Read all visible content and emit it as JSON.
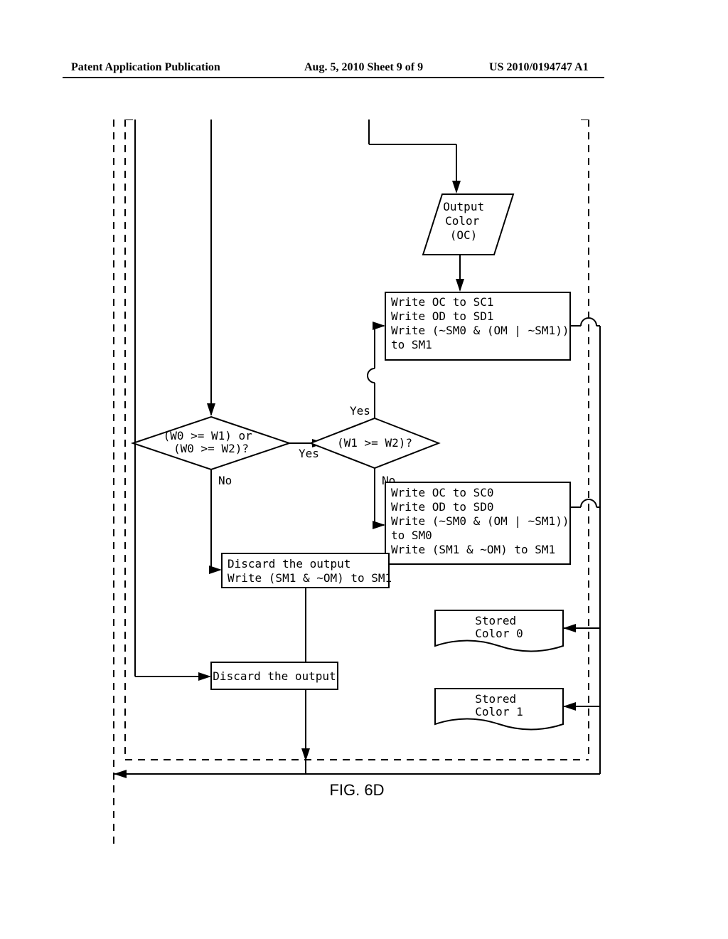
{
  "header": {
    "left": "Patent Application Publication",
    "center": "Aug. 5, 2010  Sheet 9 of 9",
    "right": "US 2010/0194747 A1"
  },
  "nodes": {
    "output_color": "Output\nColor\n(OC)",
    "write_sc1": "Write OC to SC1\nWrite OD to SD1\nWrite (~SM0 & (OM | ~SM1))\nto SM1",
    "decision1": "(W0 >= W1) or\n(W0 >= W2)?",
    "decision2": "(W1 >= W2)?",
    "write_sc0": "Write OC to SC0\nWrite OD to SD0\nWrite (~SM0 & (OM | ~SM1))\nto SM0\nWrite (SM1 & ~OM) to SM1",
    "discard_sm1": "Discard the output\nWrite (SM1 & ~OM) to SM1",
    "discard": "Discard the output",
    "stored0": "Stored\nColor 0",
    "stored1": "Stored\nColor 1",
    "yes1": "Yes",
    "no1": "No",
    "yes2": "Yes",
    "no2": "No"
  },
  "figure_label": "FIG. 6D"
}
